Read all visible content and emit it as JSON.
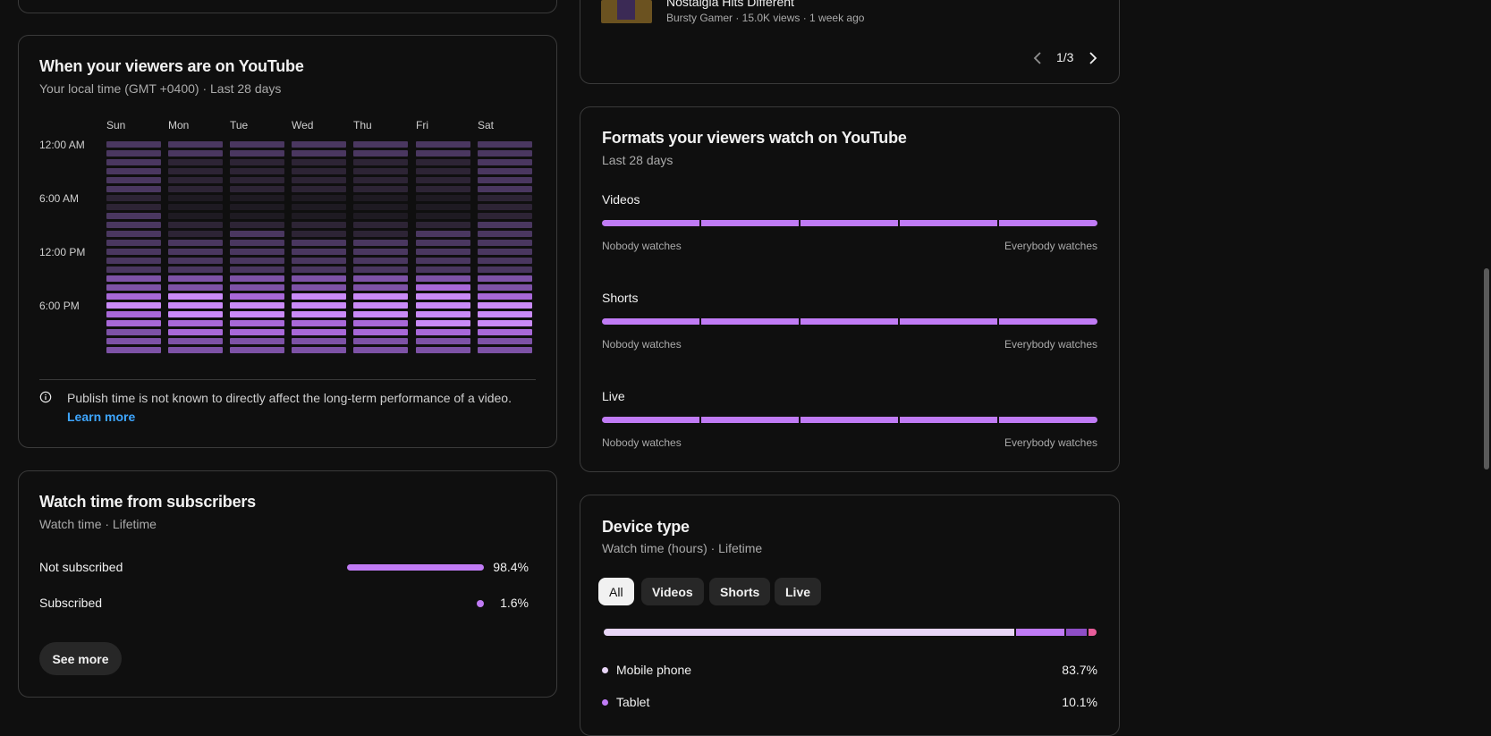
{
  "viewers_time": {
    "title": "When your viewers are on YouTube",
    "subtitle": "Your local time (GMT +0400) · Last 28 days",
    "days": [
      "Sun",
      "Mon",
      "Tue",
      "Wed",
      "Thu",
      "Fri",
      "Sat"
    ],
    "time_labels": [
      "12:00 AM",
      "6:00 AM",
      "12:00 PM",
      "6:00 PM"
    ],
    "heatmap_levels": [
      [
        2,
        2,
        2,
        2,
        2,
        2,
        2
      ],
      [
        2,
        2,
        2,
        2,
        2,
        2,
        2
      ],
      [
        2,
        1,
        1,
        1,
        1,
        1,
        2
      ],
      [
        2,
        1,
        1,
        1,
        1,
        1,
        2
      ],
      [
        2,
        1,
        1,
        1,
        1,
        1,
        2
      ],
      [
        2,
        1,
        1,
        1,
        1,
        1,
        2
      ],
      [
        1,
        0,
        0,
        0,
        0,
        0,
        1
      ],
      [
        1,
        0,
        0,
        0,
        0,
        0,
        1
      ],
      [
        2,
        0,
        0,
        0,
        0,
        0,
        1
      ],
      [
        2,
        1,
        1,
        1,
        1,
        1,
        2
      ],
      [
        2,
        1,
        2,
        1,
        1,
        2,
        2
      ],
      [
        2,
        2,
        2,
        2,
        2,
        2,
        2
      ],
      [
        2,
        2,
        2,
        2,
        2,
        2,
        2
      ],
      [
        2,
        2,
        2,
        2,
        2,
        2,
        2
      ],
      [
        2,
        2,
        2,
        2,
        2,
        2,
        2
      ],
      [
        3,
        3,
        3,
        3,
        3,
        3,
        3
      ],
      [
        3,
        3,
        3,
        3,
        3,
        4,
        3
      ],
      [
        4,
        5,
        4,
        5,
        5,
        5,
        4
      ],
      [
        5,
        5,
        5,
        5,
        5,
        5,
        5
      ],
      [
        4,
        5,
        5,
        5,
        5,
        5,
        5
      ],
      [
        4,
        4,
        4,
        4,
        4,
        5,
        5
      ],
      [
        3,
        4,
        4,
        4,
        4,
        4,
        4
      ],
      [
        3,
        3,
        3,
        3,
        3,
        3,
        3
      ],
      [
        3,
        3,
        3,
        3,
        3,
        3,
        3
      ]
    ],
    "level_colors": [
      "#1e1a22",
      "#2d2435",
      "#4a3760",
      "#7d52a6",
      "#a868d8",
      "#c98af7"
    ],
    "note": "Publish time is not known to directly affect the long-term performance of a video.",
    "learn_more": "Learn more"
  },
  "subscribers": {
    "title": "Watch time from subscribers",
    "subtitle": "Watch time · Lifetime",
    "rows": [
      {
        "label": "Not subscribed",
        "value": "98.4%",
        "fraction": 0.984
      },
      {
        "label": "Subscribed",
        "value": "1.6%",
        "fraction": 0.016
      }
    ],
    "see_more": "See more"
  },
  "top_video": {
    "title": "Nostalgia Hits Different",
    "meta": "Bursty Gamer · 15.0K views · 1 week ago",
    "pager": "1/3"
  },
  "formats": {
    "title": "Formats your viewers watch on YouTube",
    "subtitle": "Last 28 days",
    "items": [
      {
        "label": "Videos",
        "left": "Nobody watches",
        "right": "Everybody watches"
      },
      {
        "label": "Shorts",
        "left": "Nobody watches",
        "right": "Everybody watches"
      },
      {
        "label": "Live",
        "left": "Nobody watches",
        "right": "Everybody watches"
      }
    ]
  },
  "device": {
    "title": "Device type",
    "subtitle": "Watch time (hours) · Lifetime",
    "chips": [
      "All",
      "Videos",
      "Shorts",
      "Live"
    ],
    "active_chip": "All",
    "rows": [
      {
        "label": "Mobile phone",
        "value": "83.7%",
        "color": "#e8d5f7"
      },
      {
        "label": "Tablet",
        "value": "10.1%",
        "color": "#c07bf5"
      }
    ],
    "bar_segments": [
      {
        "share": 0.837,
        "color": "#e8d5f7"
      },
      {
        "share": 0.101,
        "color": "#c07bf5"
      },
      {
        "share": 0.045,
        "color": "#8e4ec6"
      },
      {
        "share": 0.017,
        "color": "#e85d9a"
      }
    ]
  }
}
